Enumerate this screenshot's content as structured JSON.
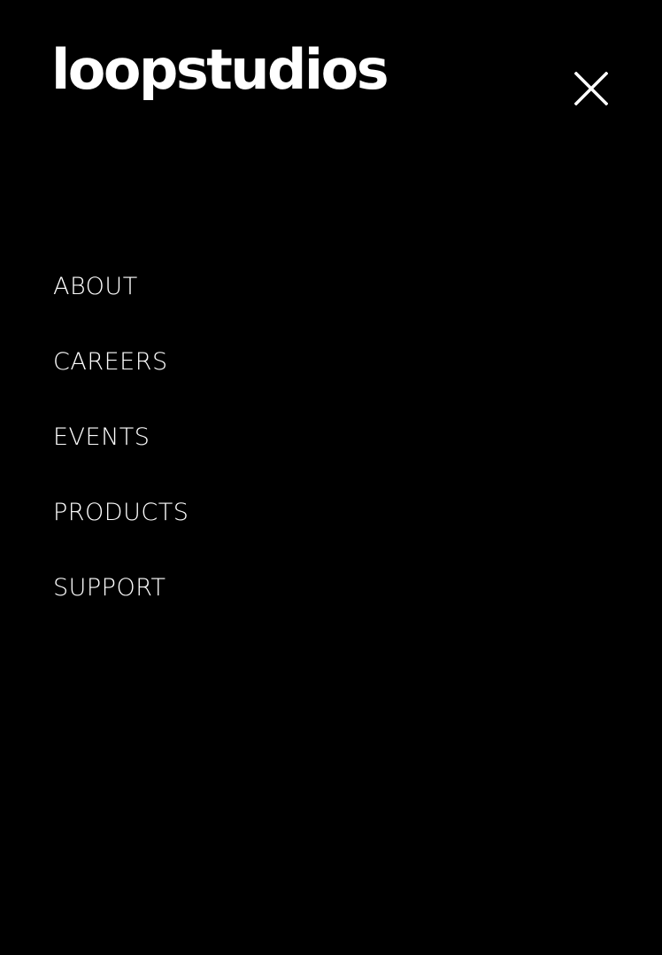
{
  "header": {
    "logo_text": "loopstudios",
    "close_icon": "close-icon"
  },
  "nav": {
    "items": [
      {
        "label": "ABOUT"
      },
      {
        "label": "CAREERS"
      },
      {
        "label": "EVENTS"
      },
      {
        "label": "PRODUCTS"
      },
      {
        "label": "SUPPORT"
      }
    ]
  },
  "colors": {
    "background": "#000000",
    "text": "#ffffff"
  }
}
